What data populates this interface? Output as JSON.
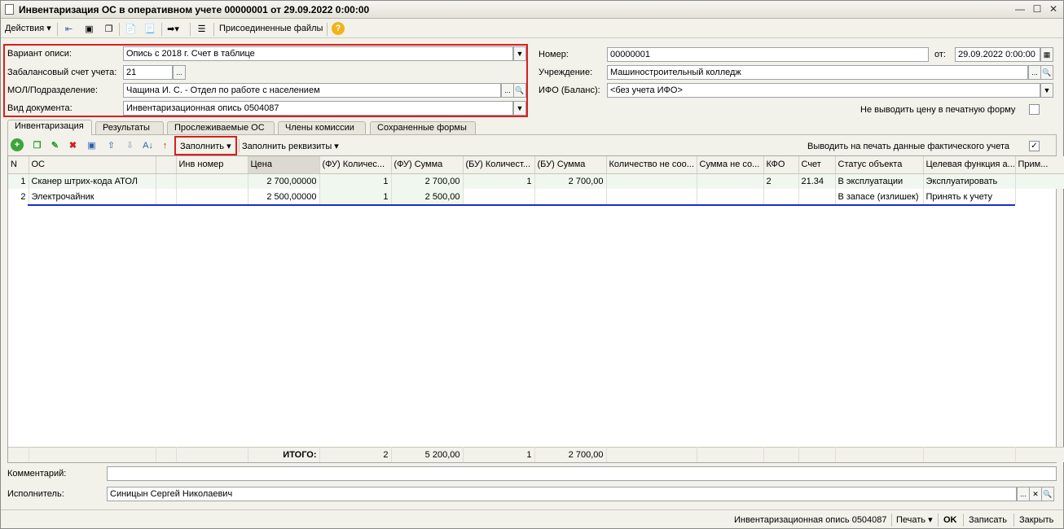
{
  "window": {
    "title": "Инвентаризация ОС в оперативном учете 00000001 от 29.09.2022 0:00:00"
  },
  "toolbar": {
    "actions": "Действия",
    "attached": "Присоединенные файлы"
  },
  "form": {
    "variant_label": "Вариант описи:",
    "variant_value": "Опись с 2018 г. Счет в таблице",
    "account_label": "Забалансовый счет учета:",
    "account_value": "21",
    "mol_label": "МОЛ/Подразделение:",
    "mol_value": "Чащина И. С. - Отдел по работе с населением",
    "doctype_label": "Вид документа:",
    "doctype_value": "Инвентаризационная опись 0504087",
    "number_label": "Номер:",
    "number_value": "00000001",
    "date_label": "от:",
    "date_value": "29.09.2022  0:00:00",
    "org_label": "Учреждение:",
    "org_value": "Машиностроительный колледж",
    "ifo_label": "ИФО (Баланс):",
    "ifo_value": "<без учета ИФО>",
    "noprice_label": "Не выводить цену в печатную форму"
  },
  "tabs": [
    "Инвентаризация",
    "Результаты",
    "Прослеживаемые ОС",
    "Члены комиссии",
    "Сохраненные формы"
  ],
  "table_toolbar": {
    "fill": "Заполнить",
    "fill_req": "Заполнить реквизиты",
    "print_actual": "Выводить на печать данные фактического учета"
  },
  "grid": {
    "columns": [
      "N",
      "ОС",
      "",
      "Инв номер",
      "Цена",
      "(ФУ) Количес...",
      "(ФУ) Сумма",
      "(БУ) Количест...",
      "(БУ) Сумма",
      "Количество не соо...",
      "Сумма не со...",
      "КФО",
      "Счет",
      "Статус объекта",
      "Целевая функция а...",
      "Прим..."
    ],
    "rows": [
      [
        "1",
        "Сканер штрих-кода АТОЛ",
        "",
        "",
        "2 700,00000",
        "1",
        "2 700,00",
        "1",
        "2 700,00",
        "",
        "",
        "2",
        "21.34",
        "В эксплуатации",
        "Эксплуатировать",
        ""
      ],
      [
        "2",
        "Электрочайник",
        "",
        "",
        "2 500,00000",
        "1",
        "2 500,00",
        "",
        "",
        "",
        "",
        "",
        "",
        "В запасе (излишек)",
        "Принять к учету",
        ""
      ]
    ],
    "totals": {
      "label": "ИТОГО:",
      "fu_qty": "2",
      "fu_sum": "5 200,00",
      "bu_qty": "1",
      "bu_sum": "2 700,00"
    }
  },
  "bottom": {
    "comment_label": "Комментарий:",
    "comment_value": "",
    "executor_label": "Исполнитель:",
    "executor_value": "Синицын Сергей Николаевич"
  },
  "status_bar": {
    "doc": "Инвентаризационная опись 0504087",
    "print": "Печать",
    "ok": "OK",
    "save": "Записать",
    "close": "Закрыть"
  },
  "colors": {
    "highlight_red": "#d81f1f",
    "underline_blue": "#1a2ec8"
  }
}
